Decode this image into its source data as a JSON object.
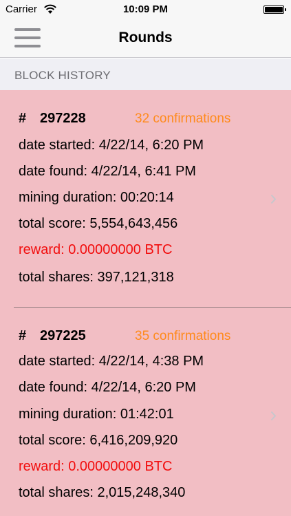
{
  "status_bar": {
    "carrier": "Carrier",
    "time": "10:09 PM",
    "icons": [
      "wifi-icon",
      "battery-icon"
    ]
  },
  "nav": {
    "title": "Rounds",
    "menu_icon": "hamburger-menu-icon"
  },
  "section": {
    "header": "BLOCK HISTORY"
  },
  "colors": {
    "row_background": "#f2bec4",
    "confirmations": "#ff8a1c",
    "reward": "#f20d0d",
    "section_background": "#efeff4"
  },
  "rounds": [
    {
      "hash": "#",
      "block": "297228",
      "confirmations": "32 confirmations",
      "date_started": "date started: 4/22/14, 6:20 PM",
      "date_found": "date found: 4/22/14, 6:41 PM",
      "mining_duration": "mining duration: 00:20:14",
      "total_score": "total score: 5,554,643,456",
      "reward": "reward: 0.00000000 BTC",
      "total_shares": "total shares: 397,121,318"
    },
    {
      "hash": "#",
      "block": "297225",
      "confirmations": "35 confirmations",
      "date_started": "date started: 4/22/14, 4:38 PM",
      "date_found": "date found: 4/22/14, 6:20 PM",
      "mining_duration": "mining duration: 01:42:01",
      "total_score": "total score: 6,416,209,920",
      "reward": "reward: 0.00000000 BTC",
      "total_shares": "total shares: 2,015,248,340"
    }
  ]
}
